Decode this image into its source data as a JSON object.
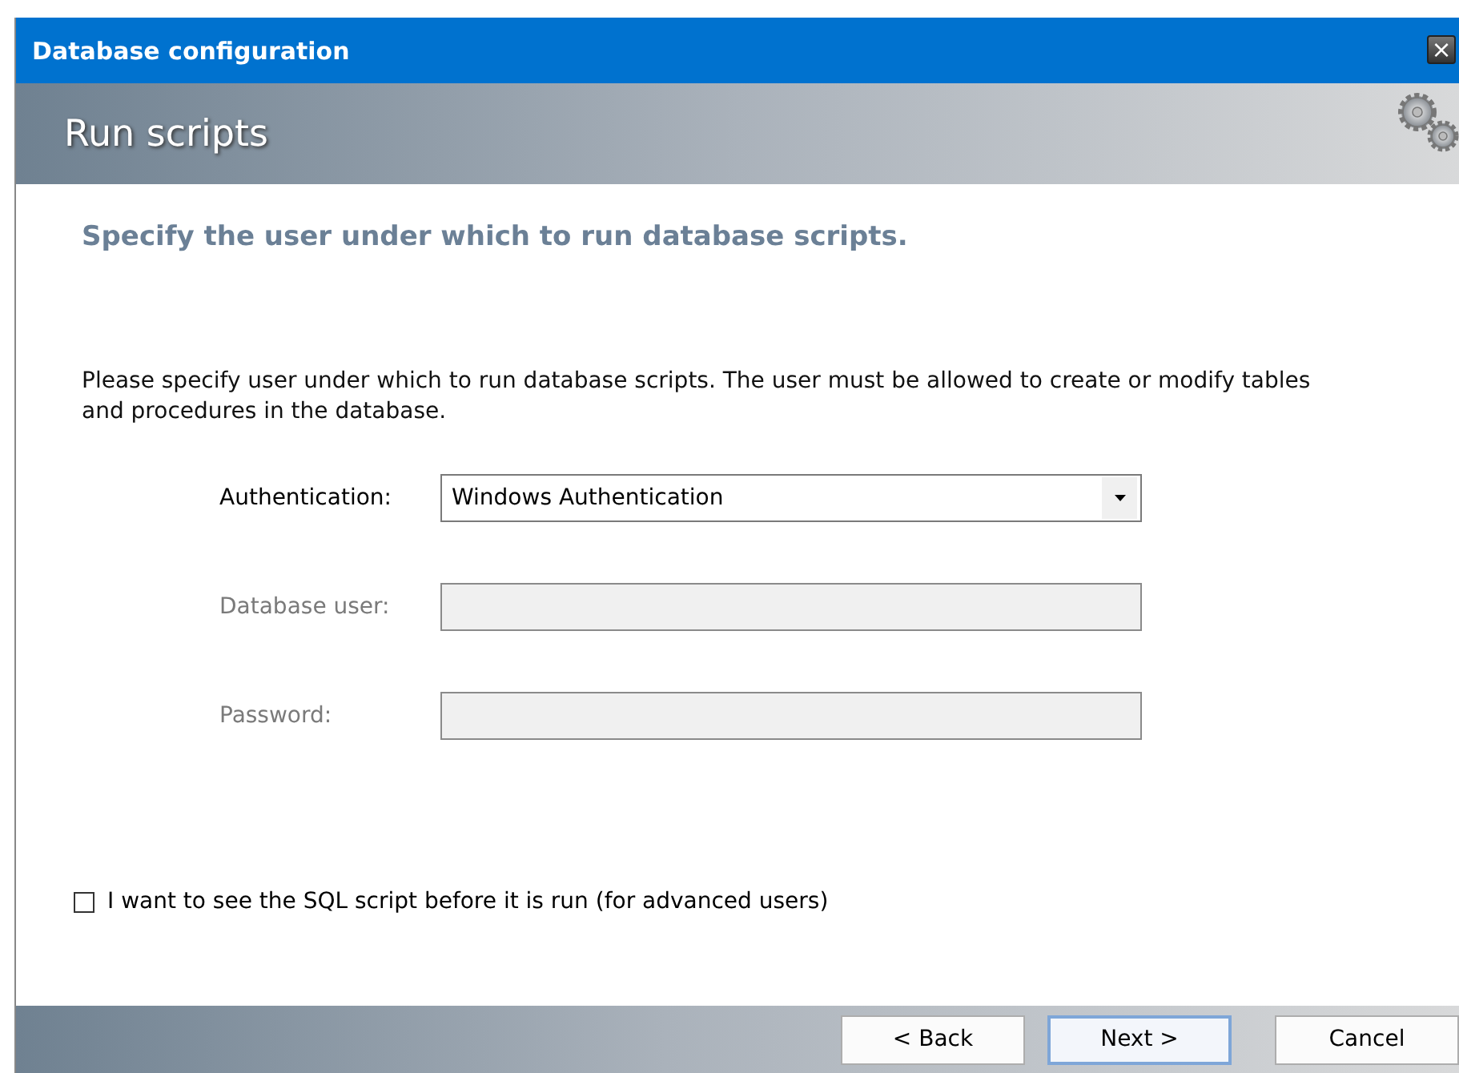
{
  "window": {
    "title": "Database configuration",
    "close": "×"
  },
  "header": {
    "title": "Run scripts"
  },
  "heading": "Specify the user under which to run database scripts.",
  "description": "Please specify user under which to run database scripts. The user must be allowed to create or modify tables and procedures in the database.",
  "fields": [
    {
      "kind": "dropdown",
      "label": "Authentication:",
      "value": "Windows Authentication",
      "disabled": false
    },
    {
      "kind": "text",
      "label": "Database user:",
      "disabled": true
    },
    {
      "kind": "text",
      "label": "Password:",
      "disabled": true
    }
  ],
  "checkbox": {
    "label": "I want to see the SQL script before it is run (for advanced users)",
    "checked": false
  },
  "buttons": [
    {
      "label": "< Back",
      "default": false
    },
    {
      "label": "Next >",
      "default": true
    },
    {
      "label": "Cancel",
      "default": false
    }
  ]
}
